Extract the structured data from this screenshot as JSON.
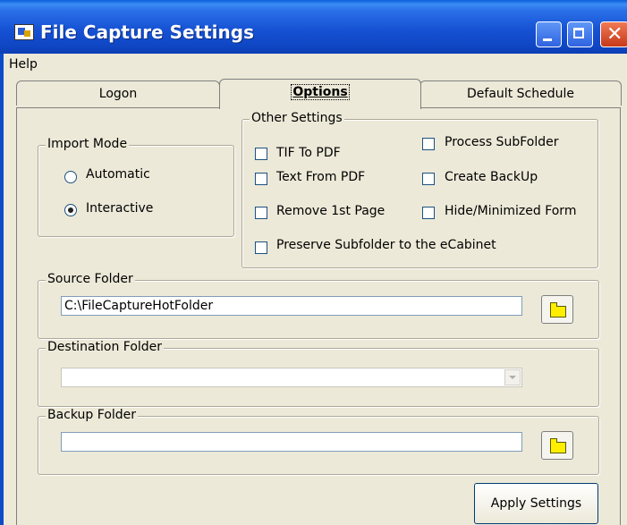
{
  "window": {
    "title": "File Capture Settings"
  },
  "menu": {
    "help": "Help"
  },
  "tabs": [
    {
      "label": "Logon",
      "active": false
    },
    {
      "label": "Options",
      "active": true
    },
    {
      "label": "Default Schedule",
      "active": false
    }
  ],
  "import_mode": {
    "legend": "Import Mode",
    "options": [
      {
        "label": "Automatic",
        "selected": false
      },
      {
        "label": "Interactive",
        "selected": true
      }
    ]
  },
  "other_settings": {
    "legend": "Other Settings",
    "checkboxes": [
      {
        "label": "TIF To PDF",
        "checked": false
      },
      {
        "label": "Process SubFolder",
        "checked": false
      },
      {
        "label": "Text From PDF",
        "checked": false
      },
      {
        "label": "Create BackUp",
        "checked": false
      },
      {
        "label": "Remove 1st Page",
        "checked": false
      },
      {
        "label": "Hide/Minimized Form",
        "checked": false
      },
      {
        "label": "Preserve Subfolder to the eCabinet",
        "checked": false
      }
    ]
  },
  "source_folder": {
    "legend": "Source Folder",
    "value": "C:\\FileCaptureHotFolder"
  },
  "destination_folder": {
    "legend": "Destination Folder",
    "value": ""
  },
  "backup_folder": {
    "legend": "Backup Folder",
    "value": ""
  },
  "buttons": {
    "apply": "Apply Settings"
  }
}
